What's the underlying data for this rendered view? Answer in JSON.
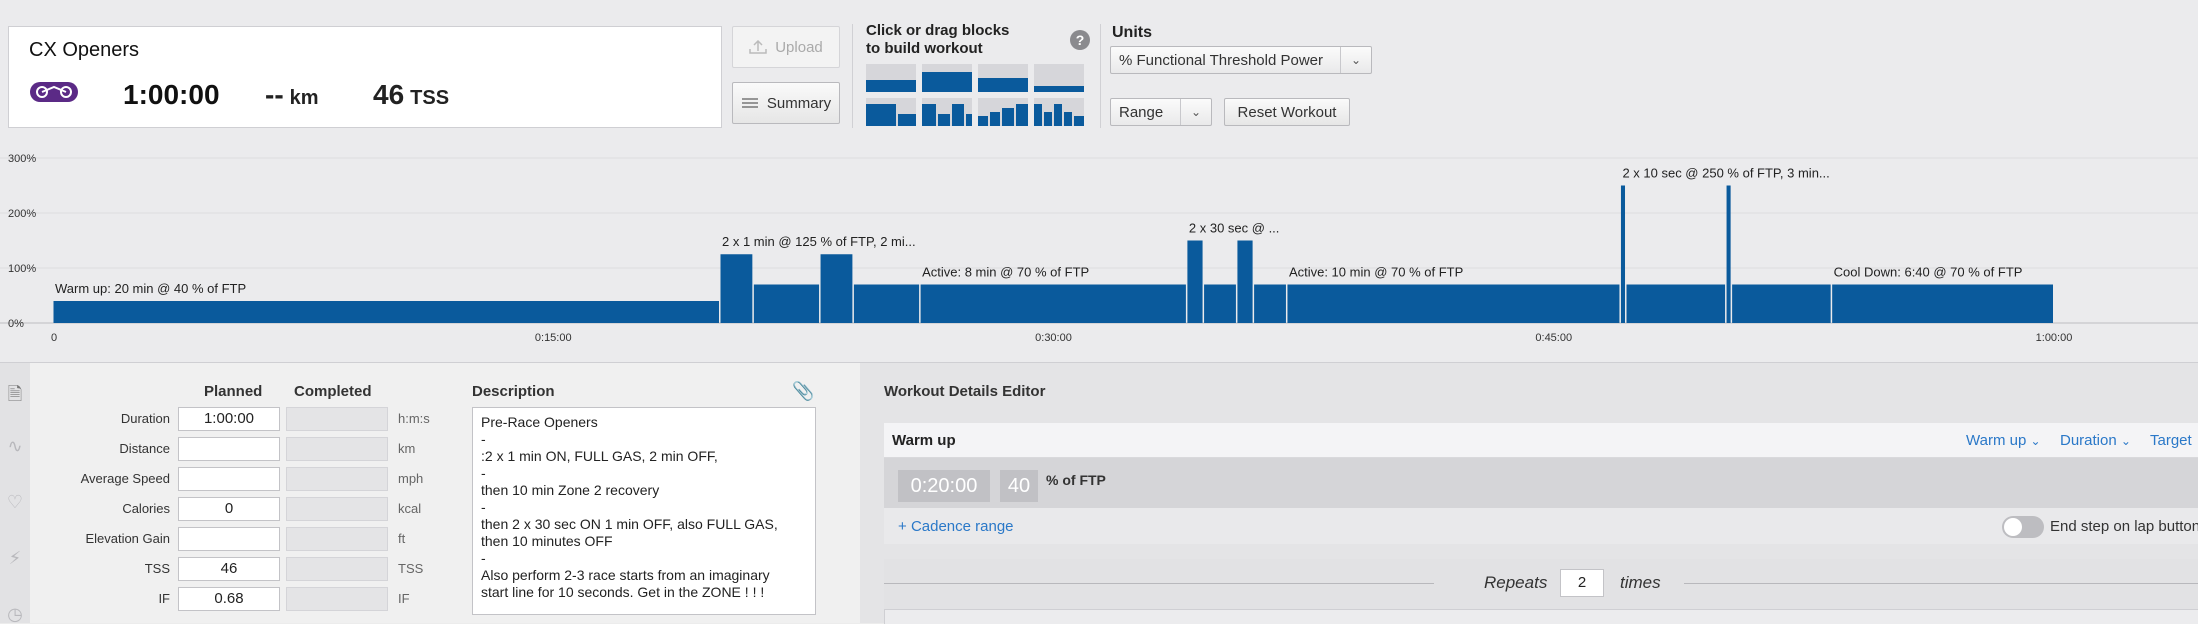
{
  "workout": {
    "title": "CX Openers",
    "duration": "1:00:00",
    "distance": "--",
    "distance_unit": "km",
    "tss": "46",
    "tss_unit": "TSS",
    "sport_icon": "bike-icon"
  },
  "toolbar": {
    "upload_label": "Upload",
    "summary_label": "Summary",
    "blocks_title_line1": "Click or drag blocks",
    "blocks_title_line2": "to build workout",
    "help_label": "?",
    "units_label": "Units",
    "units_value": "% Functional Threshold Power",
    "range_value": "Range",
    "reset_label": "Reset Workout"
  },
  "chart_data": {
    "type": "bar",
    "x_unit": "seconds",
    "x_ticks": [
      "0",
      "0:15:00",
      "0:30:00",
      "0:45:00",
      "1:00:00"
    ],
    "x_tick_values": [
      0,
      900,
      1800,
      2700,
      3600
    ],
    "y_ticks": [
      "0%",
      "100%",
      "200%",
      "300%"
    ],
    "y_tick_values": [
      0,
      100,
      200,
      300
    ],
    "ylim": [
      0,
      300
    ],
    "xlim": [
      0,
      3600
    ],
    "color": "#0a5a9c",
    "segments": [
      {
        "start": 0,
        "end": 1200,
        "value": 40
      },
      {
        "start": 1200,
        "end": 1260,
        "value": 125
      },
      {
        "start": 1260,
        "end": 1380,
        "value": 70
      },
      {
        "start": 1380,
        "end": 1440,
        "value": 125
      },
      {
        "start": 1440,
        "end": 1560,
        "value": 70
      },
      {
        "start": 1560,
        "end": 2040,
        "value": 70
      },
      {
        "start": 2040,
        "end": 2070,
        "value": 150
      },
      {
        "start": 2070,
        "end": 2130,
        "value": 70
      },
      {
        "start": 2130,
        "end": 2160,
        "value": 150
      },
      {
        "start": 2160,
        "end": 2220,
        "value": 70
      },
      {
        "start": 2220,
        "end": 2820,
        "value": 70
      },
      {
        "start": 2820,
        "end": 2830,
        "value": 250
      },
      {
        "start": 2830,
        "end": 3010,
        "value": 70
      },
      {
        "start": 3010,
        "end": 3020,
        "value": 250
      },
      {
        "start": 3020,
        "end": 3200,
        "value": 70
      },
      {
        "start": 3200,
        "end": 3600,
        "value": 70
      }
    ],
    "annotations": [
      {
        "text": "Warm up: 20 min @ 40 % of FTP",
        "x": 0,
        "y": 55
      },
      {
        "text": "2 x 1 min @ 125 % of FTP, 2 mi...",
        "x": 1200,
        "y": 140
      },
      {
        "text": "Active: 8 min @ 70 % of FTP",
        "x": 1560,
        "y": 85
      },
      {
        "text": "2 x 30 sec @ ...",
        "x": 2040,
        "y": 165
      },
      {
        "text": "Active: 10 min @ 70 % of FTP",
        "x": 2220,
        "y": 85
      },
      {
        "text": "2 x 10 sec @ 250 % of FTP, 3 min...",
        "x": 2820,
        "y": 265
      },
      {
        "text": "Cool Down: 6:40 @ 70 % of FTP",
        "x": 3200,
        "y": 85
      }
    ]
  },
  "details": {
    "col_planned": "Planned",
    "col_completed": "Completed",
    "col_description": "Description",
    "rows": [
      {
        "label": "Duration",
        "planned": "1:00:00",
        "completed": "",
        "unit": "h:m:s"
      },
      {
        "label": "Distance",
        "planned": "",
        "completed": "",
        "unit": "km"
      },
      {
        "label": "Average Speed",
        "planned": "",
        "completed": "",
        "unit": "mph"
      },
      {
        "label": "Calories",
        "planned": "0",
        "completed": "",
        "unit": "kcal"
      },
      {
        "label": "Elevation Gain",
        "planned": "",
        "completed": "",
        "unit": "ft"
      },
      {
        "label": "TSS",
        "planned": "46",
        "completed": "",
        "unit": "TSS"
      },
      {
        "label": "IF",
        "planned": "0.68",
        "completed": "",
        "unit": "IF"
      }
    ],
    "description_lines": [
      "Pre-Race Openers",
      "-",
      ":2 x 1 min ON, FULL GAS, 2 min OFF,",
      "-",
      "then 10 min Zone 2 recovery",
      "-",
      "then 2 x 30 sec ON 1 min OFF, also FULL GAS,",
      "then 10 minutes OFF",
      "-",
      "Also perform 2-3 race starts from an imaginary",
      "start line for 10 seconds. Get in the ZONE ! ! !"
    ]
  },
  "editor": {
    "title": "Workout Details Editor",
    "step_title": "Warm up",
    "step_type": "Warm up",
    "step_length_type": "Duration",
    "target_label": "Target",
    "duration_value": "0:20:00",
    "intensity_value": "40",
    "intensity_unit": "% of FTP",
    "cadence_link": "Cadence range",
    "end_step_label": "End step on lap button",
    "repeats_label": "Repeats",
    "repeats_value": "2",
    "times_label": "times"
  }
}
